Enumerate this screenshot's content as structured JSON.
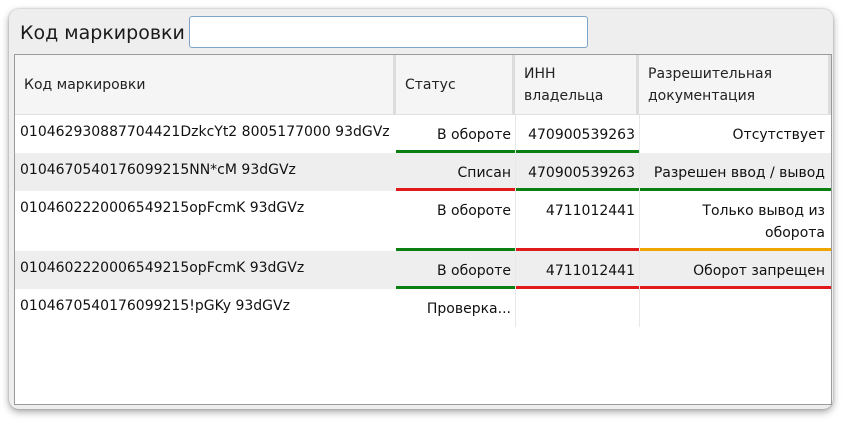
{
  "search": {
    "label": "Код маркировки",
    "value": "",
    "placeholder": ""
  },
  "columns": [
    {
      "label": "Код маркировки"
    },
    {
      "label": "Статус"
    },
    {
      "label": "ИНН владельца"
    },
    {
      "label": "Разрешительная документация"
    }
  ],
  "rows": [
    {
      "code": "010462930887704421DzkcYt2 8005177000 93dGVz",
      "status": "В обороте",
      "inn": "470900539263",
      "doc": "Отсутствует",
      "status_color": "#0a7f12",
      "inn_color": "#0a7f12",
      "doc_color": ""
    },
    {
      "code": "0104670540176099215NN*cM 93dGVz",
      "status": "Списан",
      "inn": "470900539263",
      "doc": "Разрешен ввод / вывод",
      "status_color": "#e0191a",
      "inn_color": "#0a7f12",
      "doc_color": "#0a7f12"
    },
    {
      "code": "0104602220006549215opFcmK 93dGVz",
      "status": "В обороте",
      "inn": "4711012441",
      "doc": "Только вывод из оборота",
      "status_color": "#0a7f12",
      "inn_color": "#e0191a",
      "doc_color": "#f0a400"
    },
    {
      "code": "0104602220006549215opFcmK 93dGVz",
      "status": "В обороте",
      "inn": "4711012441",
      "doc": "Оборот запрещен",
      "status_color": "#0a7f12",
      "inn_color": "#e0191a",
      "doc_color": "#e0191a"
    },
    {
      "code": "0104670540176099215!pGKy 93dGVz",
      "status": "Проверка...",
      "inn": "",
      "doc": "",
      "status_color": "",
      "inn_color": "",
      "doc_color": ""
    }
  ]
}
